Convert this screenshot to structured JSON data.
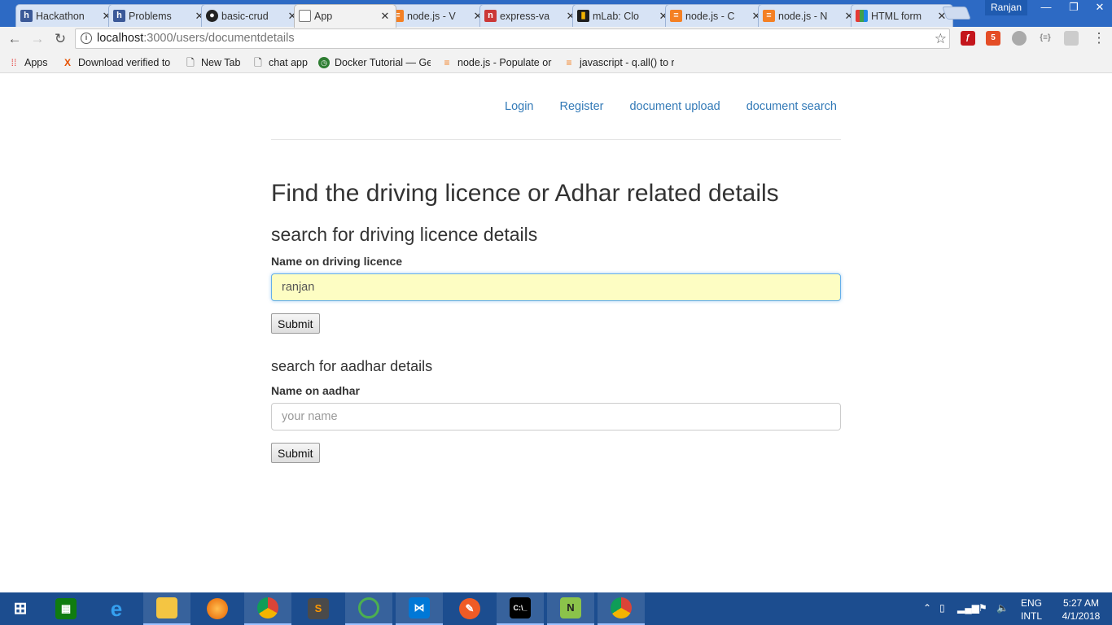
{
  "browser": {
    "tabs": [
      {
        "title": "Hackathon",
        "favicon": "hackerearth-icon",
        "color": "#3b5998"
      },
      {
        "title": "Problems",
        "favicon": "hackerearth-icon",
        "color": "#3b5998"
      },
      {
        "title": "basic-crud",
        "favicon": "github-icon",
        "color": "#222222"
      },
      {
        "title": "App",
        "favicon": "page-icon",
        "color": "#ffffff"
      },
      {
        "title": "node.js - V",
        "favicon": "stackoverflow-icon",
        "color": "#f48024"
      },
      {
        "title": "express-va",
        "favicon": "npm-icon",
        "color": "#cb3837"
      },
      {
        "title": "mLab: Clo",
        "favicon": "mlab-icon",
        "color": "#1e1e1e"
      },
      {
        "title": "node.js - C",
        "favicon": "stackoverflow-icon",
        "color": "#f48024"
      },
      {
        "title": "node.js - N",
        "favicon": "stackoverflow-icon",
        "color": "#f48024"
      },
      {
        "title": "HTML form",
        "favicon": "w3schools-icon",
        "color": "#4caf50"
      }
    ],
    "profile_name": "Ranjan",
    "url_host": "localhost",
    "url_rest": ":3000/users/documentdetails",
    "bookmarks": [
      {
        "label": "Apps",
        "icon": "apps-grid-icon"
      },
      {
        "label": "Download verified to",
        "icon": "x-icon"
      },
      {
        "label": "New Tab",
        "icon": "page-icon"
      },
      {
        "label": "chat app",
        "icon": "page-icon"
      },
      {
        "label": "Docker Tutorial — Ge",
        "icon": "clock-icon"
      },
      {
        "label": "node.js - Populate or",
        "icon": "stackoverflow-icon"
      },
      {
        "label": "javascript - q.all() to r",
        "icon": "stackoverflow-icon"
      }
    ]
  },
  "page": {
    "nav": [
      "Login",
      "Register",
      "document upload",
      "document search"
    ],
    "title": "Find the driving licence or Adhar related details",
    "licence": {
      "heading": "search for driving licence details",
      "label": "Name on driving licence",
      "value": "ranjan",
      "submit": "Submit"
    },
    "aadhar": {
      "heading": "search for aadhar details",
      "label": "Name on aadhar",
      "placeholder": "your name",
      "submit": "Submit"
    }
  },
  "taskbar": {
    "apps": [
      "windows-start-icon",
      "store-icon",
      "internet-explorer-icon",
      "file-explorer-icon",
      "firefox-icon",
      "chrome-icon",
      "sublime-text-icon",
      "app-icon",
      "vscode-icon",
      "postman-icon",
      "cmd-icon",
      "notepad-plus-icon",
      "chrome-icon"
    ],
    "lang_top": "ENG",
    "lang_bottom": "INTL",
    "time": "5:27 AM",
    "date": "4/1/2018"
  }
}
